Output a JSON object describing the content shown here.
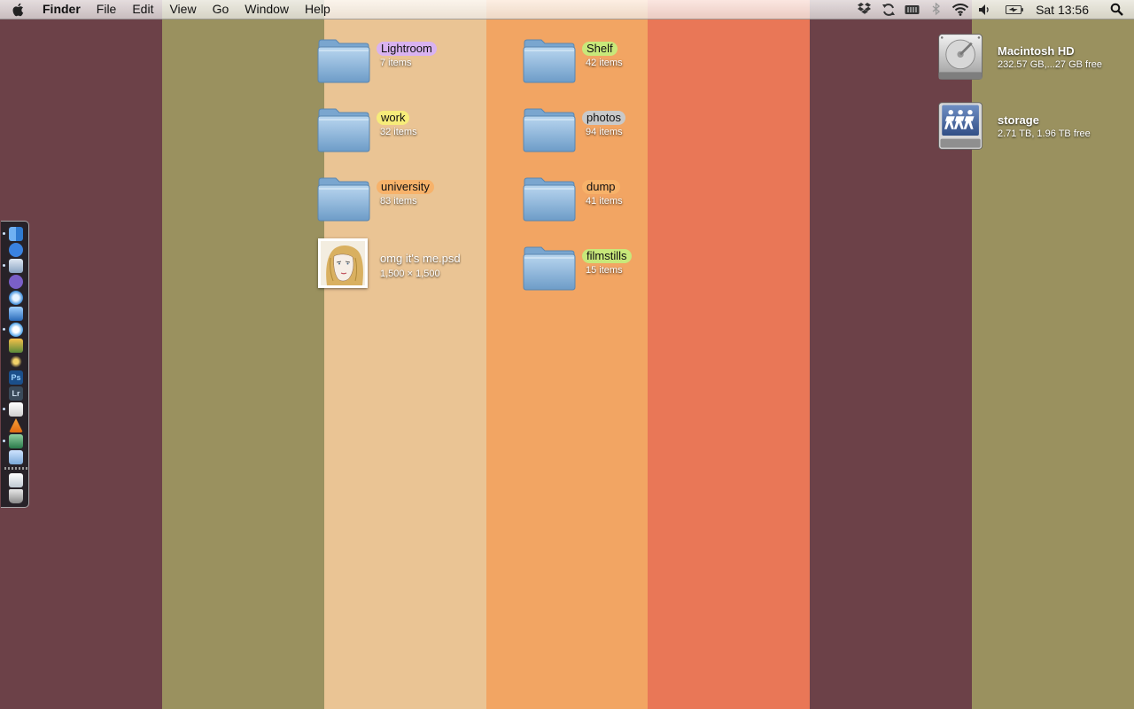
{
  "wallpaper": {
    "stripe_colors": [
      "#6c4148",
      "#9a915f",
      "#eac494",
      "#f2a563",
      "#e97757",
      "#6c4148",
      "#9a915f"
    ]
  },
  "menubar": {
    "app_name": "Finder",
    "menus": [
      "File",
      "Edit",
      "View",
      "Go",
      "Window",
      "Help"
    ],
    "status_icons": [
      "dropbox-icon",
      "sync-icon",
      "battery-meter-icon",
      "bluetooth-icon",
      "wifi-icon",
      "volume-icon",
      "battery-charging-icon"
    ],
    "clock": "Sat 13:56"
  },
  "desktop": {
    "folders": [
      {
        "name": "Lightroom",
        "count": "7 items",
        "label_color": "#d9b3f0"
      },
      {
        "name": "work",
        "count": "32 items",
        "label_color": "#f7ec7a"
      },
      {
        "name": "university",
        "count": "83 items",
        "label_color": "#f7b26a"
      },
      {
        "name": "Shelf",
        "count": "42 items",
        "label_color": "#c8e87a"
      },
      {
        "name": "photos",
        "count": "94 items",
        "label_color": "#c9c9c9"
      },
      {
        "name": "dump",
        "count": "41 items",
        "label_color": "#f7b26a"
      },
      {
        "name": "filmstills",
        "count": "15 items",
        "label_color": "#c8e87a"
      }
    ],
    "file": {
      "name": "omg it's me.psd",
      "info": "1,500 × 1,500"
    },
    "drives": [
      {
        "name": "Macintosh HD",
        "info": "232.57 GB,...27 GB free",
        "icon": "hard-drive-icon"
      },
      {
        "name": "storage",
        "info": "2.71 TB, 1.96 TB free",
        "icon": "network-share-icon"
      }
    ]
  },
  "dock": {
    "items": [
      {
        "icon": "finder-icon",
        "running": true
      },
      {
        "icon": "ichat-icon",
        "running": false
      },
      {
        "icon": "mail-icon",
        "running": true
      },
      {
        "icon": "messenger-icon",
        "running": false
      },
      {
        "icon": "safari-icon",
        "running": false
      },
      {
        "icon": "preview-icon",
        "running": false
      },
      {
        "icon": "itunes-icon",
        "running": true
      },
      {
        "icon": "iphoto-icon",
        "running": false
      },
      {
        "icon": "starburst-icon",
        "running": false
      },
      {
        "icon": "photoshop-icon",
        "running": false,
        "text": "Ps"
      },
      {
        "icon": "lightroom-icon",
        "running": false,
        "text": "Lr"
      },
      {
        "icon": "textedit-icon",
        "running": true
      },
      {
        "icon": "vlc-icon",
        "running": false
      },
      {
        "icon": "utility-icon",
        "running": true
      },
      {
        "icon": "documents-stack-icon",
        "running": false
      },
      {
        "icon": "downloads-stack-icon",
        "running": false
      },
      {
        "icon": "trash-icon",
        "running": false
      }
    ]
  }
}
